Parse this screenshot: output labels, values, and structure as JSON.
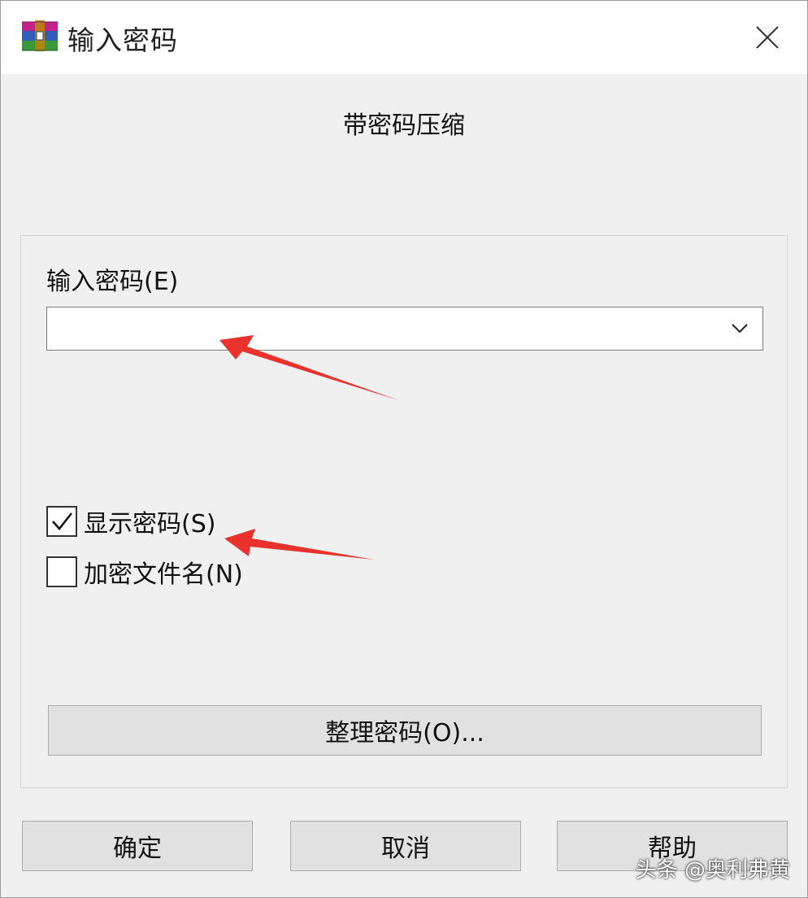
{
  "window": {
    "title": "输入密码",
    "app_icon": "winrar-books-icon",
    "close_icon": "close-icon"
  },
  "header": {
    "label": "带密码压缩"
  },
  "password": {
    "label": "输入密码(E)",
    "value": "",
    "dropdown_icon": "chevron-down-icon"
  },
  "options": {
    "show_password": {
      "label": "显示密码(S)",
      "checked": true
    },
    "encrypt_filenames": {
      "label": "加密文件名(N)",
      "checked": false
    }
  },
  "buttons": {
    "organize_label": "整理密码(O)...",
    "ok_label": "确定",
    "cancel_label": "取消",
    "help_label": "帮助"
  },
  "watermark": {
    "text": "头条 @奥利弗黄"
  },
  "colors": {
    "annotation_arrow": "#e8322b",
    "title_bar": "#ffffff",
    "dialog_bg": "#f0f0f0"
  }
}
